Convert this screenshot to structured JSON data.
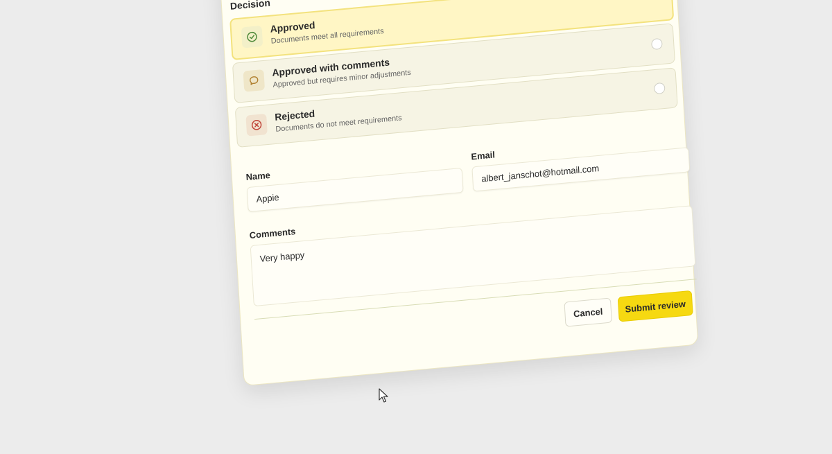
{
  "form": {
    "decision_label": "Decision",
    "options": [
      {
        "title": "Approved",
        "description": "Documents meet all requirements",
        "icon": "check-circle-icon",
        "selected": true
      },
      {
        "title": "Approved with comments",
        "description": "Approved but requires minor adjustments",
        "icon": "comment-icon",
        "selected": false
      },
      {
        "title": "Rejected",
        "description": "Documents do not meet requirements",
        "icon": "x-circle-icon",
        "selected": false
      }
    ],
    "name_label": "Name",
    "name_value": "Appie",
    "email_label": "Email",
    "email_value": "albert_janschot@hotmail.com",
    "comments_label": "Comments",
    "comments_value": "Very happy",
    "cancel_label": "Cancel",
    "submit_label": "Submit review"
  },
  "colors": {
    "accent": "#f6d911",
    "selected_bg": "#fff6c5",
    "card_bg": "#fffef3",
    "page_bg": "#ececec"
  }
}
